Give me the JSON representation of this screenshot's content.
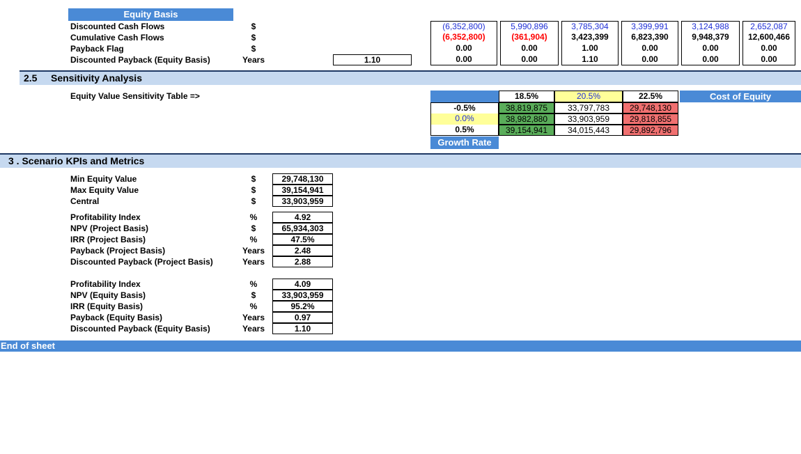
{
  "equity_basis": {
    "header": "Equity Basis",
    "rows": [
      {
        "label": "Discounted Cash Flows",
        "unit": "$",
        "values": [
          "(6,352,800)",
          "5,990,896",
          "3,785,304",
          "3,399,991",
          "3,124,988",
          "2,652,087"
        ]
      },
      {
        "label": "Cumulative Cash Flows",
        "unit": "$",
        "values": [
          "(6,352,800)",
          "(361,904)",
          "3,423,399",
          "6,823,390",
          "9,948,379",
          "12,600,466"
        ]
      },
      {
        "label": "Payback Flag",
        "unit": "$",
        "values": [
          "0.00",
          "0.00",
          "1.00",
          "0.00",
          "0.00",
          "0.00"
        ]
      },
      {
        "label": "Discounted Payback (Equity Basis)",
        "unit": "Years",
        "total": "1.10",
        "values": [
          "0.00",
          "0.00",
          "1.10",
          "0.00",
          "0.00",
          "0.00"
        ]
      }
    ]
  },
  "sensitivity": {
    "section_num": "2.5",
    "section_title": "Sensitivity Analysis",
    "table_label": "Equity Value Sensitivity Table =>",
    "col_headers": [
      "18.5%",
      "20.5%",
      "22.5%"
    ],
    "col_axis_label": "Cost of Equity",
    "row_headers": [
      "-0.5%",
      "0.0%",
      "0.5%"
    ],
    "row_axis_label": "Growth Rate",
    "grid": [
      [
        "38,819,875",
        "33,797,783",
        "29,748,130"
      ],
      [
        "38,982,880",
        "33,903,959",
        "29,818,855"
      ],
      [
        "39,154,941",
        "34,015,443",
        "29,892,796"
      ]
    ],
    "colors": {
      "low": "#f07070",
      "mid": "#ffffff",
      "high": "#5aad5a",
      "highlight": "#ffff99"
    }
  },
  "scenario": {
    "section_title": "3 . Scenario KPIs and Metrics",
    "group1": [
      {
        "label": "Min Equity Value",
        "unit": "$",
        "value": "29,748,130"
      },
      {
        "label": "Max Equity Value",
        "unit": "$",
        "value": "39,154,941"
      },
      {
        "label": "Central",
        "unit": "$",
        "value": "33,903,959"
      }
    ],
    "group2": [
      {
        "label": "Profitability Index",
        "unit": "%",
        "value": "4.92"
      },
      {
        "label": "NPV (Project Basis)",
        "unit": "$",
        "value": "65,934,303"
      },
      {
        "label": "IRR (Project Basis)",
        "unit": "%",
        "value": "47.5%"
      },
      {
        "label": "Payback  (Project Basis)",
        "unit": "Years",
        "value": "2.48"
      },
      {
        "label": "Discounted Payback  (Project Basis)",
        "unit": "Years",
        "value": "2.88"
      }
    ],
    "group3": [
      {
        "label": "Profitability Index",
        "unit": "%",
        "value": "4.09"
      },
      {
        "label": "NPV (Equity Basis)",
        "unit": "$",
        "value": "33,903,959"
      },
      {
        "label": "IRR (Equity Basis)",
        "unit": "%",
        "value": "95.2%"
      },
      {
        "label": "Payback  (Equity Basis)",
        "unit": "Years",
        "value": "0.97"
      },
      {
        "label": "Discounted Payback  (Equity Basis)",
        "unit": "Years",
        "value": "1.10"
      }
    ]
  },
  "footer": {
    "text": "End of sheet"
  }
}
